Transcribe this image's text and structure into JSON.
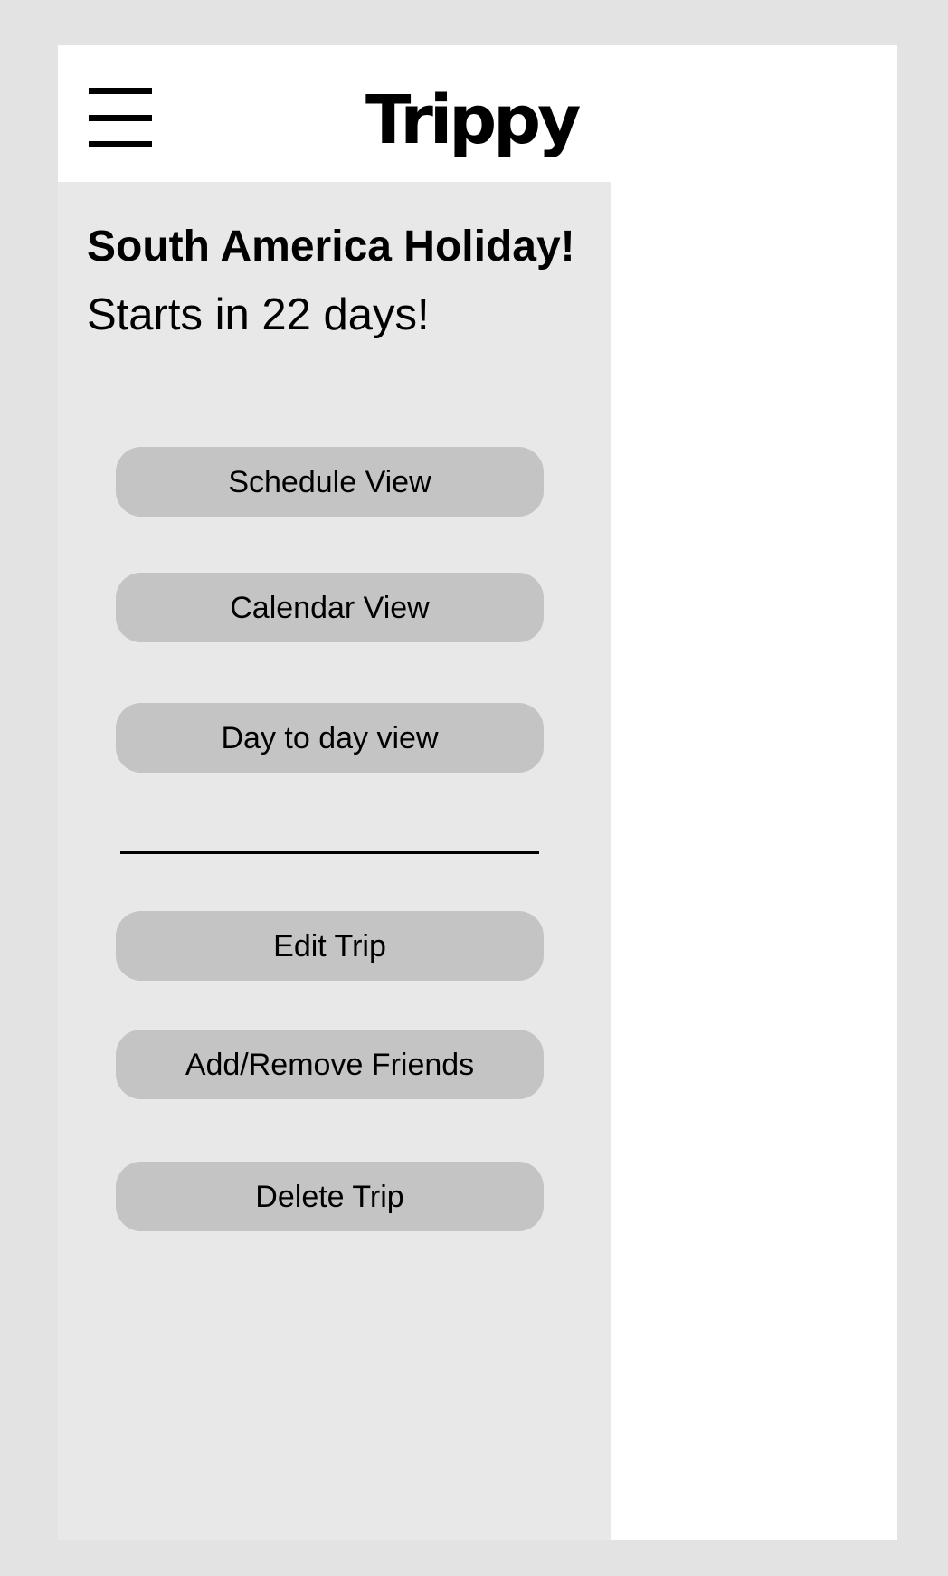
{
  "header": {
    "logo": "Trippy",
    "menu_icon": "hamburger-menu-icon"
  },
  "trip": {
    "title": "South America Holiday!",
    "countdown": "Starts in 22 days!"
  },
  "views": {
    "schedule": "Schedule View",
    "calendar": "Calendar View",
    "day_to_day": "Day to day view"
  },
  "actions": {
    "edit": "Edit Trip",
    "friends": "Add/Remove Friends",
    "delete": "Delete Trip"
  },
  "colors": {
    "page_background": "#e3e3e3",
    "drawer_background": "#e8e8e8",
    "button_background": "#c4c4c4"
  }
}
